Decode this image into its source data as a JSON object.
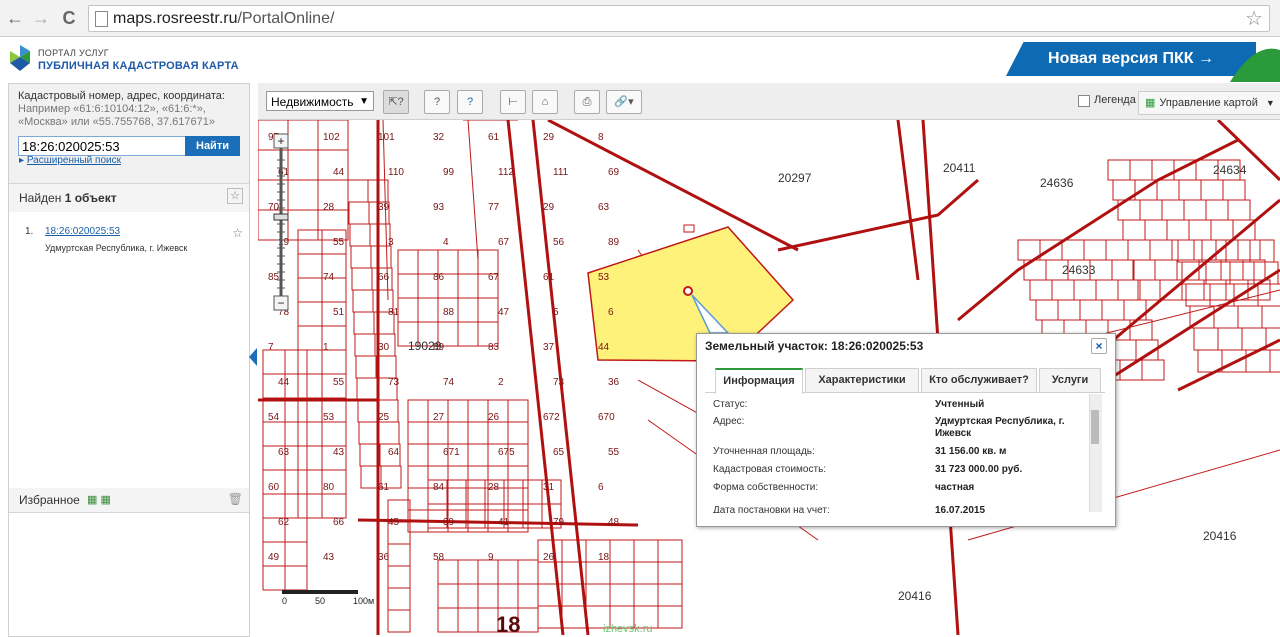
{
  "browser": {
    "url_host": "maps.rosreestr.ru",
    "url_path": "/PortalOnline/",
    "back_icon": "←",
    "forward_icon": "→",
    "reload_icon": "C",
    "bookmark_icon": "☆"
  },
  "header": {
    "portal_label": "ПОРТАЛ УСЛУГ",
    "map_name": "ПУБЛИЧНАЯ КАДАСТРОВАЯ КАРТА",
    "new_version": "Новая версия ПКК →"
  },
  "search": {
    "hint": "Кадастровый номер, адрес, координата:",
    "examples": "Например «61:6:10104:12», «61:6:*», «Москва» или «55.755768, 37.617671»",
    "value": "18:26:020025:53",
    "button": "Найти",
    "advanced": "Расширенный поиск"
  },
  "results": {
    "found_prefix": "Найден ",
    "found_count": "1 объект",
    "items": [
      {
        "num": "1.",
        "number": "18:26:020025:53",
        "address": "Удмуртская Республика, г. Ижевск"
      }
    ]
  },
  "favorites": {
    "title": "Избранное"
  },
  "toolbar": {
    "layer": "Недвижимость",
    "legend": "Легенда",
    "map_control": "Управление картой"
  },
  "popup": {
    "title": "Земельный участок: 18:26:020025:53",
    "close": "×",
    "tabs": [
      "Информация",
      "Характеристики",
      "Кто обслуживает?",
      "Услуги"
    ],
    "rows": [
      {
        "label": "Статус:",
        "value": "Учтенный"
      },
      {
        "label": "Адрес:",
        "value": "Удмуртская Республика, г. Ижевск"
      },
      {
        "label": "Уточненная площадь:",
        "value": "31 156.00 кв. м"
      },
      {
        "label": "Кадастровая стоимость:",
        "value": "31 723 000.00 руб."
      },
      {
        "label": "Форма собственности:",
        "value": "частная"
      },
      {
        "label": "Дата постановки на учет:",
        "value": "16.07.2015"
      }
    ]
  },
  "map": {
    "scale_labels": [
      "0",
      "50",
      "100м"
    ],
    "watermark": "izhevsk.ru",
    "quarter_labels": [
      "20297",
      "20411",
      "24636",
      "24634",
      "19029",
      "24633",
      "20416",
      "20416"
    ],
    "parcel_labels": [
      "97",
      "102",
      "101",
      "32",
      "61",
      "29",
      "8",
      "61",
      "44",
      "110",
      "99",
      "112",
      "111",
      "69",
      "70",
      "28",
      "39",
      "93",
      "77",
      "29",
      "63",
      "19",
      "55",
      "3",
      "4",
      "67",
      "56",
      "89",
      "85",
      "74",
      "66",
      "86",
      "67",
      "61",
      "53",
      "78",
      "51",
      "81",
      "88",
      "47",
      "5",
      "6",
      "7",
      "1",
      "30",
      "89",
      "83",
      "37",
      "44",
      "44",
      "55",
      "73",
      "74",
      "2",
      "73",
      "36",
      "54",
      "53",
      "25",
      "27",
      "26",
      "672",
      "670",
      "63",
      "43",
      "64",
      "671",
      "675",
      "65",
      "55",
      "60",
      "80",
      "61",
      "84",
      "28",
      "31",
      "6",
      "62",
      "66",
      "45",
      "39",
      "41",
      "79",
      "48",
      "49",
      "43",
      "36",
      "58",
      "9",
      "26",
      "18"
    ]
  },
  "colors": {
    "parcel_line": "#c01818",
    "selected_parcel": "#fff27a",
    "accent_blue": "#1a6fb8",
    "new_version_bg": "#0d6ab3",
    "tab_accent": "#2b9a3a"
  }
}
